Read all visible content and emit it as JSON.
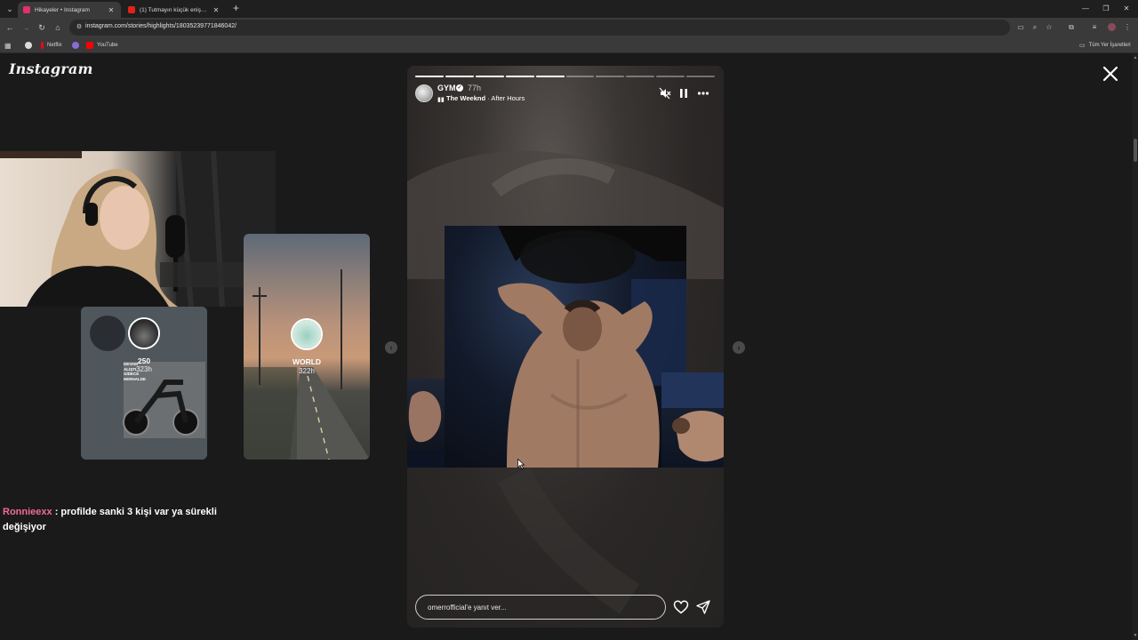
{
  "browser": {
    "tabs": [
      {
        "title": "Hikayeler • Instagram",
        "favicon_color": "#e1306c",
        "active": true
      },
      {
        "title": "(1) Tutmayın küçük enişteyi sal",
        "favicon_color": "#e62117",
        "active": false
      }
    ],
    "url": "instagram.com/stories/highlights/18035239771846042/",
    "bookmarks": [
      {
        "label": "",
        "icon_color": "#dcdcdc"
      },
      {
        "label": "Netflix",
        "icon_color": "#e50914"
      },
      {
        "label": "",
        "icon_color": "#8a6ad6"
      },
      {
        "label": "YouTube",
        "icon_color": "#ff0000"
      }
    ],
    "all_bookmarks_label": "Tüm Yer İşaretleri"
  },
  "instagram": {
    "logo": "Instagram",
    "mini_stories": [
      {
        "name": "250",
        "time": "323h"
      },
      {
        "name": "WORLD",
        "time": "322h"
      }
    ],
    "mini_overlay_text": [
      "DEVAM",
      "ALIŞTI",
      "GİDECE",
      "HERHALDE"
    ],
    "story": {
      "username": "GYM",
      "time": "77h",
      "artist": "The Weeknd",
      "song": "After Hours",
      "reply_placeholder": "omerrofficial'e yanıt ver...",
      "segments_total": 10,
      "segments_done": 5
    }
  },
  "chat": {
    "user": "Ronnieexx",
    "separator": " : ",
    "message": "profilde sanki 3 kişi var ya sürekli değişiyor"
  },
  "colors": {
    "chat_user": "#f06a9a",
    "background": "#1a1a1a"
  }
}
